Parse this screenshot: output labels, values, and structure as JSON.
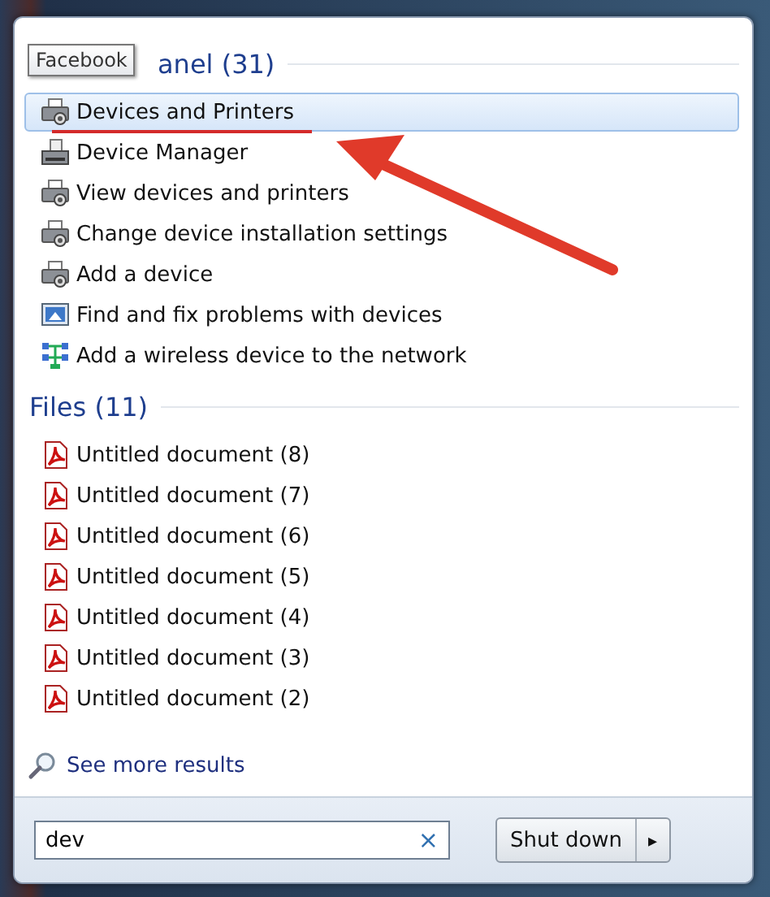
{
  "tooltip": "Facebook",
  "groups": [
    {
      "heading": "anel (31)",
      "items": [
        {
          "label": "Devices and Printers",
          "kind": "devices",
          "selected": true
        },
        {
          "label": "Device Manager",
          "kind": "manager",
          "selected": false
        },
        {
          "label": "View devices and printers",
          "kind": "devices",
          "selected": false
        },
        {
          "label": "Change device installation settings",
          "kind": "devices",
          "selected": false
        },
        {
          "label": "Add a device",
          "kind": "devices",
          "selected": false
        },
        {
          "label": "Find and fix problems with devices",
          "kind": "troubleshoot",
          "selected": false
        },
        {
          "label": "Add a wireless device to the network",
          "kind": "wireless",
          "selected": false
        }
      ]
    },
    {
      "heading": "Files (11)",
      "items": [
        {
          "label": "Untitled document (8)",
          "kind": "pdf",
          "selected": false
        },
        {
          "label": "Untitled document (7)",
          "kind": "pdf",
          "selected": false
        },
        {
          "label": "Untitled document (6)",
          "kind": "pdf",
          "selected": false
        },
        {
          "label": "Untitled document (5)",
          "kind": "pdf",
          "selected": false
        },
        {
          "label": "Untitled document (4)",
          "kind": "pdf",
          "selected": false
        },
        {
          "label": "Untitled document (3)",
          "kind": "pdf",
          "selected": false
        },
        {
          "label": "Untitled document (2)",
          "kind": "pdf",
          "selected": false
        }
      ]
    }
  ],
  "see_more": "See more results",
  "search": {
    "value": "dev",
    "clear": "×"
  },
  "shutdown": {
    "label": "Shut down",
    "arrow": "▸"
  }
}
